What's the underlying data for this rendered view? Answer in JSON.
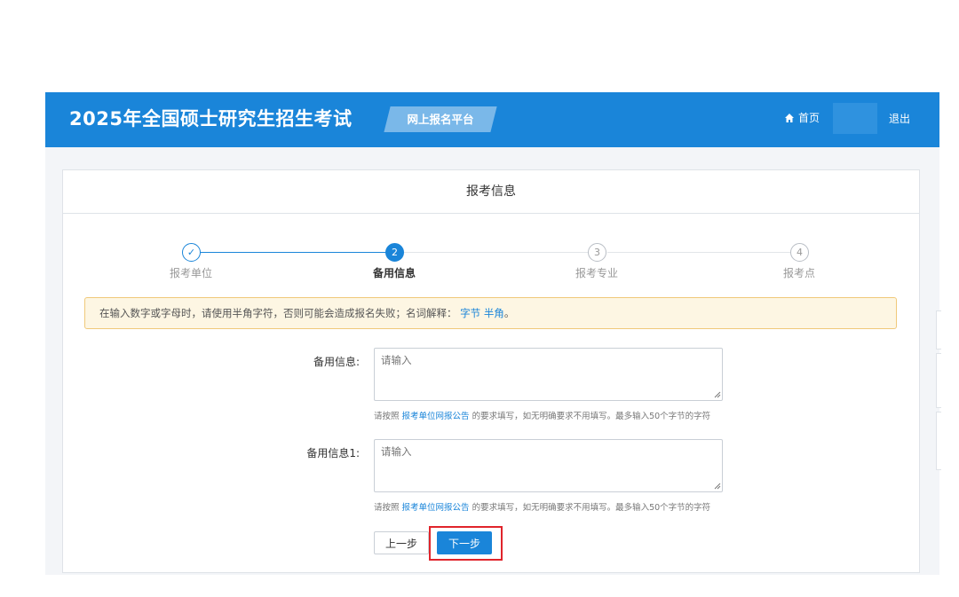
{
  "header": {
    "title": "2025年全国硕士研究生招生考试",
    "platform_label": "网上报名平台",
    "home_label": "首页",
    "logout_label": "退出",
    "brand_color": "#1a85d9"
  },
  "card": {
    "title": "报考信息"
  },
  "steps": [
    {
      "label": "报考单位",
      "marker": "✓",
      "state": "done"
    },
    {
      "label": "备用信息",
      "marker": "2",
      "state": "active"
    },
    {
      "label": "报考专业",
      "marker": "3",
      "state": "pending"
    },
    {
      "label": "报考点",
      "marker": "4",
      "state": "pending"
    }
  ],
  "notice": {
    "text": "在输入数字或字母时，请使用半角字符，否则可能会造成报名失败；名词解释：",
    "link_bytes": "字节",
    "link_halfwidth": "半角",
    "end": "。"
  },
  "form": {
    "fields": [
      {
        "label": "备用信息:",
        "placeholder": "请输入",
        "hint_prefix": "请按照",
        "hint_link": "报考单位网报公告",
        "hint_suffix": "的要求填写，如无明确要求不用填写。最多输入50个字节的字符"
      },
      {
        "label": "备用信息1:",
        "placeholder": "请输入",
        "hint_prefix": "请按照",
        "hint_link": "报考单位网报公告",
        "hint_suffix": "的要求填写，如无明确要求不用填写。最多输入50个字节的字符"
      }
    ],
    "prev_label": "上一步",
    "next_label": "下一步"
  }
}
